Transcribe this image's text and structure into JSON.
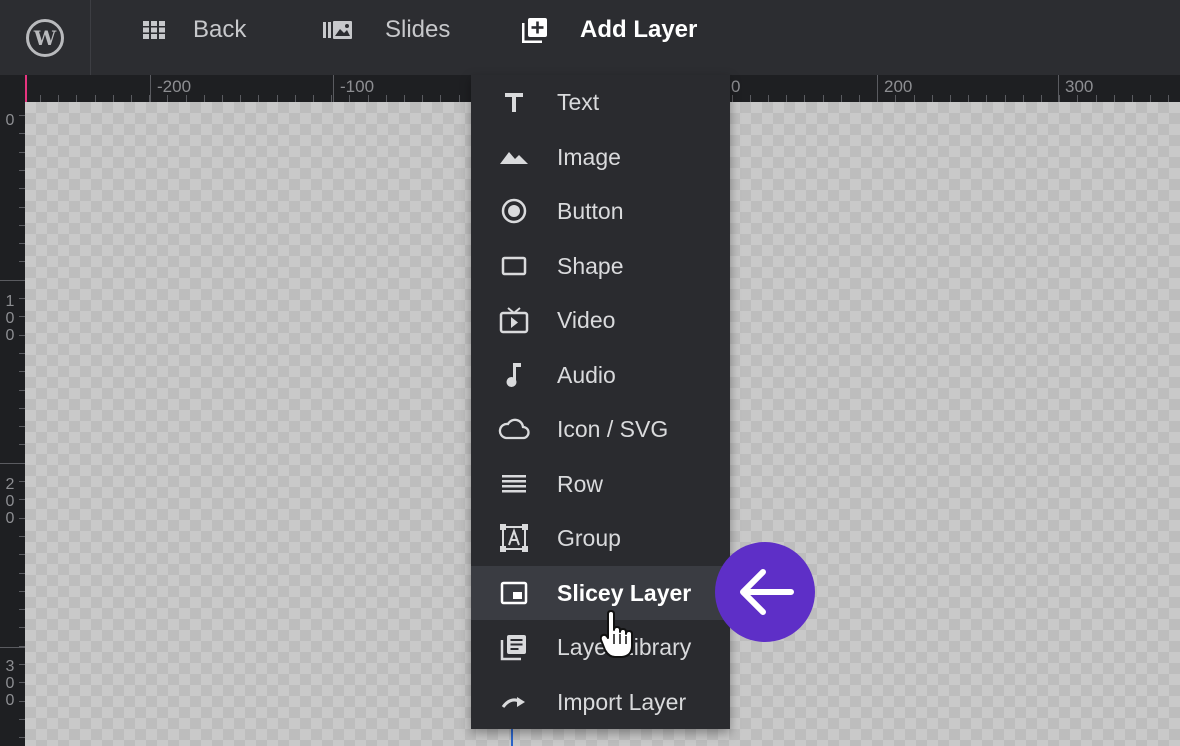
{
  "topbar": {
    "back_label": "Back",
    "slides_label": "Slides",
    "add_layer_label": "Add Layer"
  },
  "ruler": {
    "h_labels": [
      "-200",
      "-100",
      "0",
      "200",
      "300"
    ],
    "v_labels": [
      [
        "0"
      ],
      [
        "1",
        "0",
        "0"
      ],
      [
        "2",
        "0",
        "0"
      ],
      [
        "3",
        "0",
        "0"
      ]
    ]
  },
  "menu": {
    "items": [
      {
        "label": "Text",
        "icon": "text-icon"
      },
      {
        "label": "Image",
        "icon": "image-icon"
      },
      {
        "label": "Button",
        "icon": "button-icon"
      },
      {
        "label": "Shape",
        "icon": "shape-icon"
      },
      {
        "label": "Video",
        "icon": "video-icon"
      },
      {
        "label": "Audio",
        "icon": "audio-icon"
      },
      {
        "label": "Icon / SVG",
        "icon": "cloud-icon"
      },
      {
        "label": "Row",
        "icon": "row-icon"
      },
      {
        "label": "Group",
        "icon": "group-icon"
      },
      {
        "label": "Slicey Layer",
        "icon": "slicey-icon"
      },
      {
        "label": "Layer Library",
        "icon": "library-icon"
      },
      {
        "label": "Import Layer",
        "icon": "import-icon"
      }
    ],
    "hovered_index": 9
  },
  "colors": {
    "badge": "#5e2fc7",
    "topbar": "#2c2d31",
    "menu": "#2a2b2f",
    "ruler_marker": "#e6347f"
  }
}
